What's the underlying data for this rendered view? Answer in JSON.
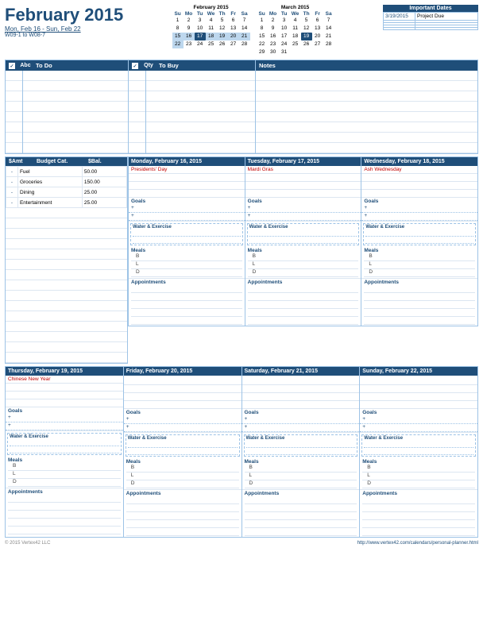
{
  "header": {
    "title": "February 2015",
    "week_range": "Mon, Feb 16 - Sun, Feb 22",
    "week_code": "W09-1 to W08-7"
  },
  "feb_calendar": {
    "title": "February 2015",
    "days_header": [
      "Su",
      "Mo",
      "Tu",
      "We",
      "Th",
      "Fr",
      "Sa"
    ],
    "weeks": [
      [
        "1",
        "2",
        "3",
        "4",
        "5",
        "6",
        "7"
      ],
      [
        "8",
        "9",
        "10",
        "11",
        "12",
        "13",
        "14"
      ],
      [
        "15",
        "16",
        "17",
        "18",
        "19",
        "20",
        "21"
      ],
      [
        "22",
        "23",
        "24",
        "25",
        "26",
        "27",
        "28"
      ]
    ],
    "today": "17",
    "highlight_week": [
      "15",
      "16",
      "17",
      "18",
      "19",
      "20",
      "21",
      "22"
    ]
  },
  "mar_calendar": {
    "title": "March 2015",
    "days_header": [
      "Su",
      "Mo",
      "Tu",
      "We",
      "Th",
      "Fr",
      "Sa"
    ],
    "weeks": [
      [
        "1",
        "2",
        "3",
        "4",
        "5",
        "6",
        "7"
      ],
      [
        "8",
        "9",
        "10",
        "11",
        "12",
        "13",
        "14"
      ],
      [
        "15",
        "16",
        "17",
        "18",
        "19",
        "20",
        "21"
      ],
      [
        "22",
        "23",
        "24",
        "25",
        "26",
        "27",
        "28"
      ],
      [
        "29",
        "30",
        "31",
        "",
        "",
        "",
        ""
      ]
    ]
  },
  "important_dates": {
    "header": "Important Dates",
    "rows": [
      {
        "date": "3/19/2015",
        "event": "Project Due"
      },
      {
        "date": "",
        "event": ""
      },
      {
        "date": "",
        "event": ""
      },
      {
        "date": "",
        "event": ""
      },
      {
        "date": "",
        "event": ""
      }
    ]
  },
  "todo": {
    "header": "To Do",
    "checkbox": "✓",
    "abc_label": "Abc",
    "rows": 8
  },
  "tobuy": {
    "header": "To Buy",
    "checkbox": "✓",
    "qty_label": "Qty",
    "rows": 8
  },
  "notes": {
    "header": "Notes",
    "rows": 8
  },
  "budget": {
    "col1": "$Amt",
    "col2": "Budget Cat.",
    "col3": "$Bal.",
    "rows": [
      {
        "sign": "-",
        "cat": "Fuel",
        "bal": "50.00"
      },
      {
        "sign": "-",
        "cat": "Groceries",
        "bal": "150.00"
      },
      {
        "sign": "-",
        "cat": "Dining",
        "bal": "25.00"
      },
      {
        "sign": "-",
        "cat": "Entertainment",
        "bal": "25.00"
      }
    ],
    "filler_rows": 15
  },
  "days": [
    {
      "header": "Monday, February 16, 2015",
      "holiday": "Presidents' Day",
      "event_lines": 3,
      "goals_label": "Goals",
      "goals_lines": [
        "+",
        "+"
      ],
      "water_label": "Water & Exercise",
      "water_lines": 2,
      "meals_label": "Meals",
      "meals": [
        "B",
        "L",
        "D"
      ],
      "appt_label": "Appointments",
      "appt_lines": 5
    },
    {
      "header": "Tuesday, February 17, 2015",
      "holiday": "Mardi Gras",
      "event_lines": 3,
      "goals_label": "Goals",
      "goals_lines": [
        "+",
        "+"
      ],
      "water_label": "Water & Exercise",
      "water_lines": 2,
      "meals_label": "Meals",
      "meals": [
        "B",
        "L",
        "D"
      ],
      "appt_label": "Appointments",
      "appt_lines": 5
    },
    {
      "header": "Wednesday, February 18, 2015",
      "holiday": "Ash Wednesday",
      "event_lines": 3,
      "goals_label": "Goals",
      "goals_lines": [
        "+",
        "+"
      ],
      "water_label": "Water & Exercise",
      "water_lines": 2,
      "meals_label": "Meals",
      "meals": [
        "B",
        "L",
        "D"
      ],
      "appt_label": "Appointments",
      "appt_lines": 5
    }
  ],
  "days_bottom": [
    {
      "header": "Thursday, February 19, 2015",
      "holiday": "Chinese New Year",
      "event_lines": 3,
      "goals_label": "Goals",
      "goals_lines": [
        "+",
        "+"
      ],
      "water_label": "Water & Exercise",
      "water_lines": 2,
      "meals_label": "Meals",
      "meals": [
        "B",
        "L",
        "D"
      ],
      "appt_label": "Appointments",
      "appt_lines": 5
    },
    {
      "header": "Friday, February 20, 2015",
      "holiday": "",
      "event_lines": 3,
      "goals_label": "Goals",
      "goals_lines": [
        "+",
        "+"
      ],
      "water_label": "Water & Exercise",
      "water_lines": 2,
      "meals_label": "Meals",
      "meals": [
        "B",
        "L",
        "D"
      ],
      "appt_label": "Appointments",
      "appt_lines": 5
    },
    {
      "header": "Saturday, February 21, 2015",
      "holiday": "",
      "event_lines": 3,
      "goals_label": "Goals",
      "goals_lines": [
        "+",
        "+"
      ],
      "water_label": "Water & Exercise",
      "water_lines": 2,
      "meals_label": "Meals",
      "meals": [
        "B",
        "L",
        "D"
      ],
      "appt_label": "Appointments",
      "appt_lines": 5
    },
    {
      "header": "Sunday, February 22, 2015",
      "holiday": "",
      "event_lines": 3,
      "goals_label": "Goals",
      "goals_lines": [
        "+",
        "+"
      ],
      "water_label": "Water & Exercise",
      "water_lines": 2,
      "meals_label": "Meals",
      "meals": [
        "B",
        "L",
        "D"
      ],
      "appt_label": "Appointments",
      "appt_lines": 5
    }
  ],
  "footer": {
    "copyright": "© 2015 Vertex42 LLC",
    "url": "http://www.vertex42.com/calendars/personal-planner.html"
  }
}
